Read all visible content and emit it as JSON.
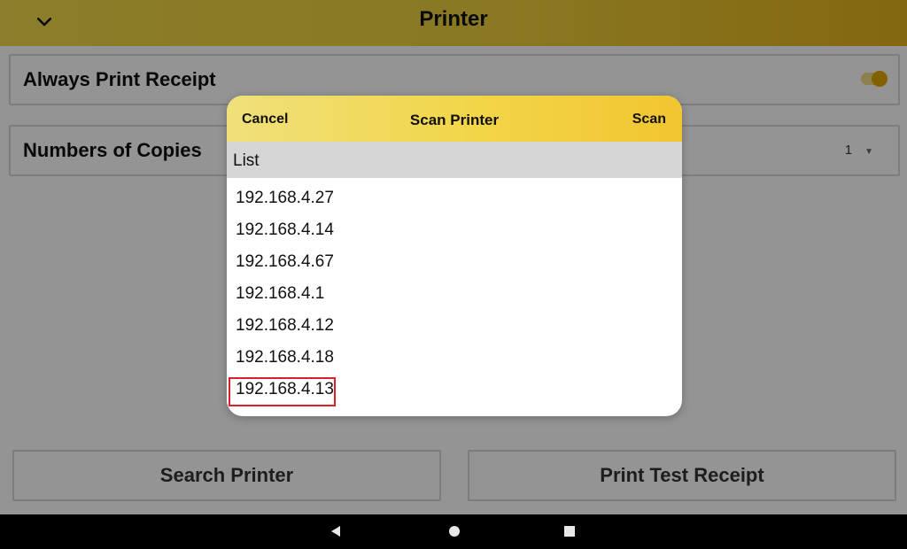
{
  "app": {
    "title": "Printer",
    "back_icon": "chevron-down-icon"
  },
  "settings": {
    "always_print_receipt_label": "Always Print Receipt",
    "always_print_receipt_enabled": true,
    "copies_label": "Numbers of Copies",
    "copies_value": "1",
    "copies_icon": "caret-down-icon"
  },
  "actions": {
    "search_printer_label": "Search Printer",
    "print_test_receipt_label": "Print Test Receipt"
  },
  "dialog": {
    "cancel_label": "Cancel",
    "title": "Scan Printer",
    "scan_label": "Scan",
    "list_header": "List",
    "printers": [
      "192.168.4.27",
      "192.168.4.14",
      "192.168.4.67",
      "192.168.4.1",
      "192.168.4.12",
      "192.168.4.18",
      "192.168.4.13"
    ],
    "highlighted_printer": "192.168.4.13"
  },
  "navbar": {
    "back_icon": "nav-back-icon",
    "home_icon": "nav-home-icon",
    "recents_icon": "nav-recents-icon"
  },
  "colors": {
    "accent_yellow": "#f2d548",
    "toggle_knob": "#e2a600",
    "highlight_red": "#dd1f2a"
  }
}
